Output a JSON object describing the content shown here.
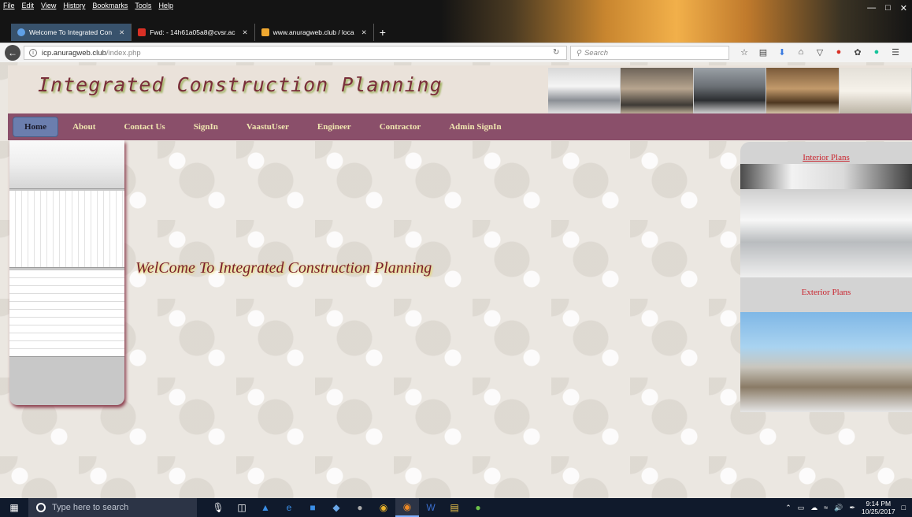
{
  "browser": {
    "menu": [
      "File",
      "Edit",
      "View",
      "History",
      "Bookmarks",
      "Tools",
      "Help"
    ],
    "tabs": [
      {
        "label": "Welcome To Integrated Con",
        "active": true
      },
      {
        "label": "Fwd: - 14h61a05a8@cvsr.ac",
        "active": false
      },
      {
        "label": "www.anuragweb.club / loca",
        "active": false
      }
    ],
    "new_tab": "+",
    "url_host": "icp.anuragweb.club",
    "url_path": "/index.php",
    "search_placeholder": "Search"
  },
  "site": {
    "title": "Integrated Construction Planning",
    "nav": [
      "Home",
      "About",
      "Contact Us",
      "SignIn",
      "VaastuUser",
      "Engineer",
      "Contractor",
      "Admin SignIn"
    ],
    "welcome": "WelCome To Integrated Construction Planning",
    "interior_label": "Interior Plans",
    "exterior_label": "Exterior Plans"
  },
  "taskbar": {
    "search_placeholder": "Type here to search",
    "time": "9:14 PM",
    "date": "10/25/2017"
  }
}
